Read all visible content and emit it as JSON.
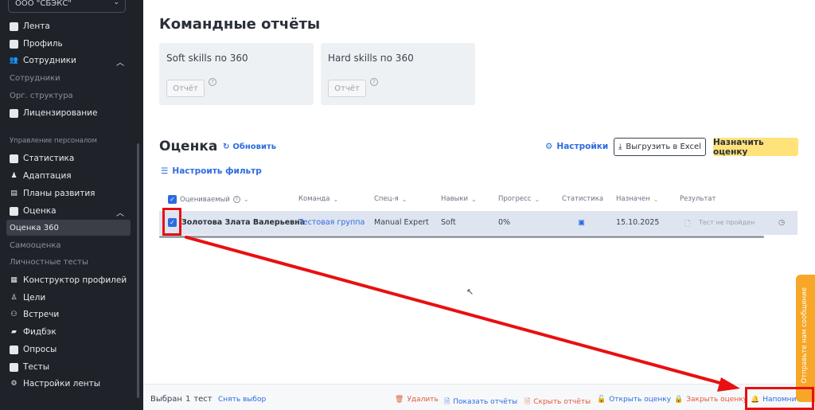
{
  "sidebar": {
    "org_select": "ООО \"СБЭКС\"",
    "items": {
      "feed": "Лента",
      "profile": "Профиль",
      "employees": "Сотрудники",
      "employees_sub1": "Сотрудники",
      "employees_sub2": "Орг. структура",
      "licensing": "Лицензирование",
      "section_hr": "Управление персоналом",
      "statistics": "Статистика",
      "adaptation": "Адаптация",
      "dev_plans": "Планы развития",
      "evaluation": "Оценка",
      "eval_360": "Оценка 360",
      "self_eval": "Самооценка",
      "personal_tests": "Личностные тесты",
      "profile_builder": "Конструктор профилей",
      "goals": "Цели",
      "meetings": "Встречи",
      "feedback": "Фидбэк",
      "surveys": "Опросы",
      "tests": "Тесты",
      "feed_settings": "Настройки ленты"
    }
  },
  "main": {
    "title": "Командные отчёты",
    "cards": [
      {
        "title": "Soft skills по 360",
        "button": "Отчёт"
      },
      {
        "title": "Hard skills по 360",
        "button": "Отчёт"
      }
    ],
    "section_title": "Оценка",
    "refresh": "Обновить",
    "settings": "Настройки",
    "export": "Выгрузить в Excel",
    "assign": "Назначить оценку",
    "filter": "Настроить фильтр",
    "columns": {
      "evaluated": "Оцениваемый",
      "team": "Команда",
      "spec": "Спец-я",
      "skills": "Навыки",
      "progress": "Прогресс",
      "statistics": "Статистика",
      "assigned": "Назначен",
      "result": "Результат"
    },
    "row": {
      "name": "Золотова Злата Валерьевна",
      "team": "Тестовая группа",
      "spec": "Manual Expert",
      "skills": "Soft",
      "progress": "0%",
      "assigned": "15.10.2025",
      "result": "Тест не пройден"
    }
  },
  "bottom_bar": {
    "selected_label": "Выбран",
    "selected_count": "1",
    "selected_unit": "тест",
    "clear": "Снять выбор",
    "delete": "Удалить",
    "show_reports": "Показать отчёты",
    "hide_reports": "Скрыть отчёты",
    "open_eval": "Открыть оценку",
    "close_eval": "Закрыть оценку",
    "remind": "Напомнить"
  },
  "feedback_widget": "Отправьте нам сообщение",
  "colors": {
    "sidebar_bg": "#1f2329",
    "accent": "#2d6cdf",
    "assign_btn": "#ffe27a",
    "annotation": "#e81010",
    "danger": "#e05a3a"
  }
}
